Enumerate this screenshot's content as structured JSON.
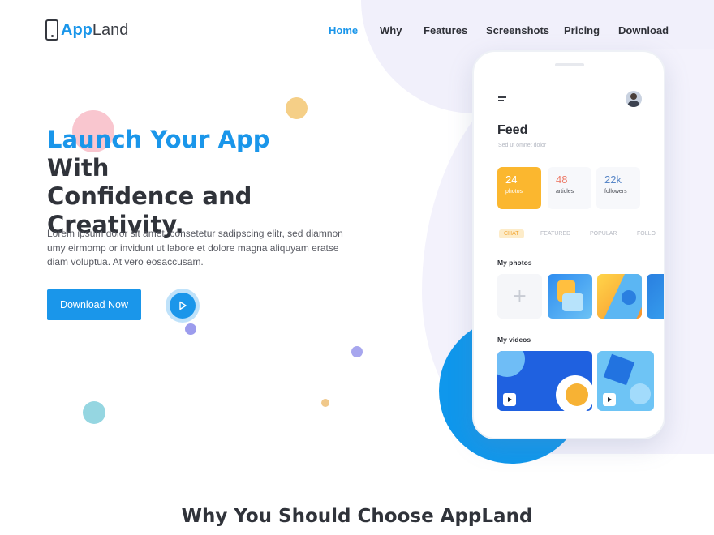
{
  "brand": {
    "name_part1": "App",
    "name_part2": "Land"
  },
  "nav": {
    "items": [
      {
        "label": "Home",
        "active": true
      },
      {
        "label": "Why",
        "active": false
      },
      {
        "label": "Features",
        "active": false
      },
      {
        "label": "Screenshots",
        "active": false
      },
      {
        "label": "Pricing",
        "active": false
      },
      {
        "label": "Download",
        "active": false
      }
    ]
  },
  "hero": {
    "title_highlight": "Launch Your App",
    "title_rest_1": " With",
    "title_line_2": "Confidence and",
    "title_line_3": "Creativity.",
    "description": "Lorem ipsum dolor sit amet, consetetur sadipscing elitr, sed diamnon umy eirmomp or invidunt ut labore et dolore magna aliquyam eratse diam voluptua. At vero eosaccusam.",
    "download_label": "Download Now",
    "play_icon": "play-icon"
  },
  "phone": {
    "feed_title": "Feed",
    "feed_subtitle": "Sed ut omnet dolor",
    "stats": [
      {
        "value": "24",
        "label": "photos"
      },
      {
        "value": "48",
        "label": "articles"
      },
      {
        "value": "22k",
        "label": "followers"
      }
    ],
    "tabs": [
      "CHAT",
      "FEATURED",
      "POPULAR",
      "FOLLO"
    ],
    "my_photos_label": "My photos",
    "add_symbol": "+",
    "my_videos_label": "My videos"
  },
  "colors": {
    "accent": "#1a96ea",
    "dark_text": "#30333a",
    "orange_card": "#fbb72f"
  },
  "section": {
    "heading": "Why You Should Choose AppLand"
  }
}
